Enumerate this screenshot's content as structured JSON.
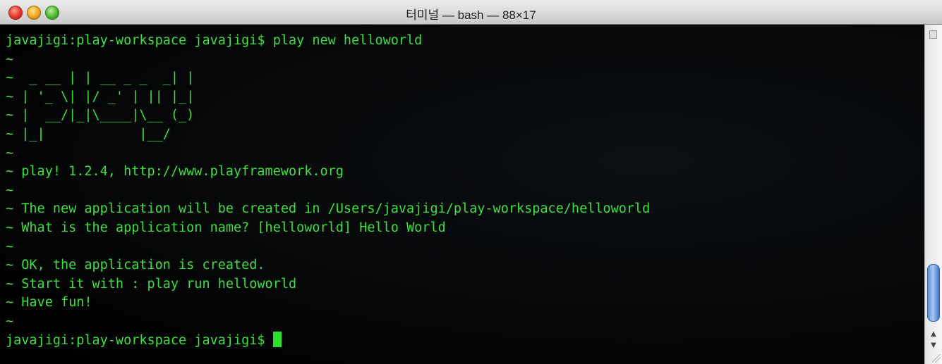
{
  "window": {
    "title": "터미널 — bash — 88×17"
  },
  "terminal": {
    "text_color": "#3be03b",
    "lines": [
      "javajigi:play-workspace javajigi$ play new helloworld",
      "~",
      "~  _ __ | | __ _ _  _| |",
      "~ | '_ \\| |/ _' | || |_|",
      "~ |  __/|_|\\____|\\__ (_)",
      "~ |_|            |__/",
      "~",
      "~ play! 1.2.4, http://www.playframework.org",
      "~",
      "~ The new application will be created in /Users/javajigi/play-workspace/helloworld",
      "~ What is the application name? [helloworld] Hello World",
      "~",
      "~ OK, the application is created.",
      "~ Start it with : play run helloworld",
      "~ Have fun!",
      "~",
      "javajigi:play-workspace javajigi$ "
    ]
  },
  "scrollbar": {
    "up_icon": "arrow-up-icon",
    "down_icon": "arrow-down-icon"
  }
}
